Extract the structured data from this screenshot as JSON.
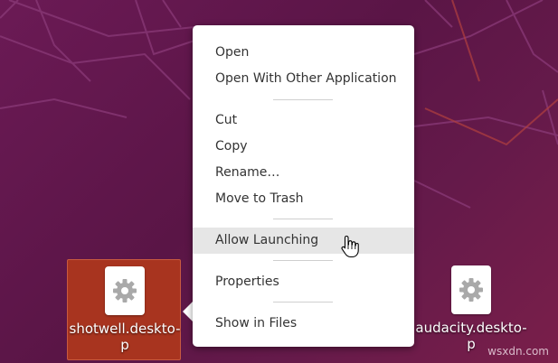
{
  "colors": {
    "desktop_bg": "#5b1646",
    "selection_bg": "#a8341f",
    "menu_bg": "#ffffff",
    "menu_hover_bg": "#e6e6e6",
    "menu_text": "#333333"
  },
  "context_menu": {
    "items": [
      {
        "label": "Open"
      },
      {
        "label": "Open With Other Application"
      },
      {
        "label": "Cut"
      },
      {
        "label": "Copy"
      },
      {
        "label": "Rename…"
      },
      {
        "label": "Move to Trash"
      },
      {
        "label": "Allow Launching",
        "state": "hovered"
      },
      {
        "label": "Properties"
      },
      {
        "label": "Show in Files"
      }
    ]
  },
  "desktop_icons": [
    {
      "name_line1": "shotwell.deskto-",
      "name_line2": "p",
      "icon": "gear-icon",
      "selected": true
    },
    {
      "name_line1": "audacity.deskto-",
      "name_line2": "p",
      "icon": "gear-icon",
      "selected": false
    }
  ],
  "cursor": {
    "icon": "hand-pointer-icon"
  },
  "watermark": {
    "text": "wsxdn.com"
  }
}
